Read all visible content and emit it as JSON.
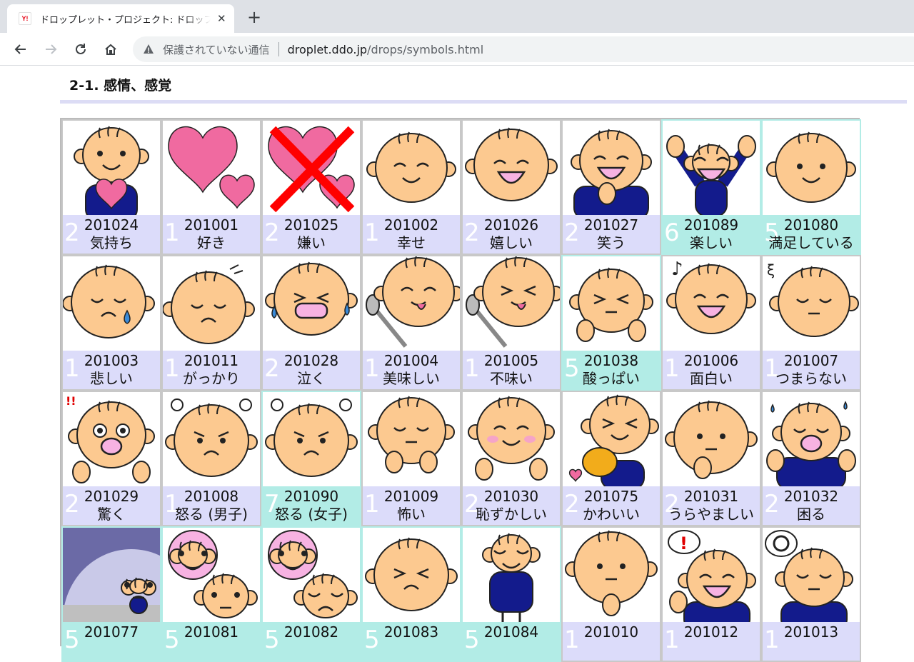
{
  "browser": {
    "tab_title": "ドロップレット・プロジェクト: ドロップス シンボル",
    "favicon_text": "Y!",
    "security_label": "保護されていない通信",
    "url_host": "droplet.ddo.jp",
    "url_path": "/drops/symbols.html"
  },
  "section": {
    "title": "2-1. 感情、感覚"
  },
  "symbols": [
    {
      "id": "201024",
      "name": "気持ち",
      "count": "2",
      "variant": "purple",
      "pic": "face-heart"
    },
    {
      "id": "201001",
      "name": "好き",
      "count": "1",
      "variant": "purple",
      "pic": "hearts"
    },
    {
      "id": "201025",
      "name": "嫌い",
      "count": "2",
      "variant": "purple",
      "pic": "hearts-x"
    },
    {
      "id": "201002",
      "name": "幸せ",
      "count": "1",
      "variant": "purple",
      "pic": "face-happy"
    },
    {
      "id": "201026",
      "name": "嬉しい",
      "count": "2",
      "variant": "purple",
      "pic": "face-laugh"
    },
    {
      "id": "201027",
      "name": "笑う",
      "count": "2",
      "variant": "purple",
      "pic": "face-laugh-body"
    },
    {
      "id": "201089",
      "name": "楽しい",
      "count": "6",
      "variant": "teal",
      "pic": "arms-up"
    },
    {
      "id": "201080",
      "name": "満足している",
      "count": "5",
      "variant": "teal",
      "pic": "face-smile"
    },
    {
      "id": "201003",
      "name": "悲しい",
      "count": "1",
      "variant": "purple",
      "pic": "face-cry"
    },
    {
      "id": "201011",
      "name": "がっかり",
      "count": "1",
      "variant": "purple",
      "pic": "face-down"
    },
    {
      "id": "201028",
      "name": "泣く",
      "count": "2",
      "variant": "purple",
      "pic": "face-wail"
    },
    {
      "id": "201004",
      "name": "美味しい",
      "count": "1",
      "variant": "purple",
      "pic": "spoon-yum"
    },
    {
      "id": "201005",
      "name": "不味い",
      "count": "1",
      "variant": "purple",
      "pic": "spoon-yuck"
    },
    {
      "id": "201038",
      "name": "酸っぱい",
      "count": "5",
      "variant": "teal",
      "pic": "face-sour"
    },
    {
      "id": "201006",
      "name": "面白い",
      "count": "1",
      "variant": "purple",
      "pic": "face-fun"
    },
    {
      "id": "201007",
      "name": "つまらない",
      "count": "1",
      "variant": "purple",
      "pic": "face-bored"
    },
    {
      "id": "201029",
      "name": "驚く",
      "count": "2",
      "variant": "purple",
      "pic": "face-surprise"
    },
    {
      "id": "201008",
      "name": "怒る (男子)",
      "count": "1",
      "variant": "purple",
      "pic": "face-angry"
    },
    {
      "id": "201090",
      "name": "怒る (女子)",
      "count": "7",
      "variant": "teal",
      "pic": "face-angry"
    },
    {
      "id": "201009",
      "name": "怖い",
      "count": "1",
      "variant": "purple",
      "pic": "face-scared"
    },
    {
      "id": "201030",
      "name": "恥ずかしい",
      "count": "2",
      "variant": "purple",
      "pic": "face-shy"
    },
    {
      "id": "201075",
      "name": "かわいい",
      "count": "2",
      "variant": "purple",
      "pic": "face-cute"
    },
    {
      "id": "201031",
      "name": "うらやましい",
      "count": "2",
      "variant": "purple",
      "pic": "face-envy"
    },
    {
      "id": "201032",
      "name": "困る",
      "count": "2",
      "variant": "purple",
      "pic": "face-trouble"
    },
    {
      "id": "201077",
      "name": "",
      "count": "5",
      "variant": "teal",
      "pic": "lonely"
    },
    {
      "id": "201081",
      "name": "",
      "count": "5",
      "variant": "teal",
      "pic": "think-self"
    },
    {
      "id": "201082",
      "name": "",
      "count": "5",
      "variant": "teal",
      "pic": "think-self-sad"
    },
    {
      "id": "201083",
      "name": "",
      "count": "5",
      "variant": "teal",
      "pic": "face-grimace"
    },
    {
      "id": "201084",
      "name": "",
      "count": "5",
      "variant": "teal",
      "pic": "body-stand"
    },
    {
      "id": "201010",
      "name": "",
      "count": "1",
      "variant": "purple",
      "pic": "face-shh"
    },
    {
      "id": "201012",
      "name": "",
      "count": "1",
      "variant": "purple",
      "pic": "face-idea"
    },
    {
      "id": "201013",
      "name": "",
      "count": "1",
      "variant": "purple",
      "pic": "face-confused"
    }
  ],
  "colors": {
    "skin": "#fcc990",
    "outline": "#222222",
    "blue": "#131b8c",
    "pink": "#f06aa0",
    "mouth": "#f7b2e2"
  }
}
